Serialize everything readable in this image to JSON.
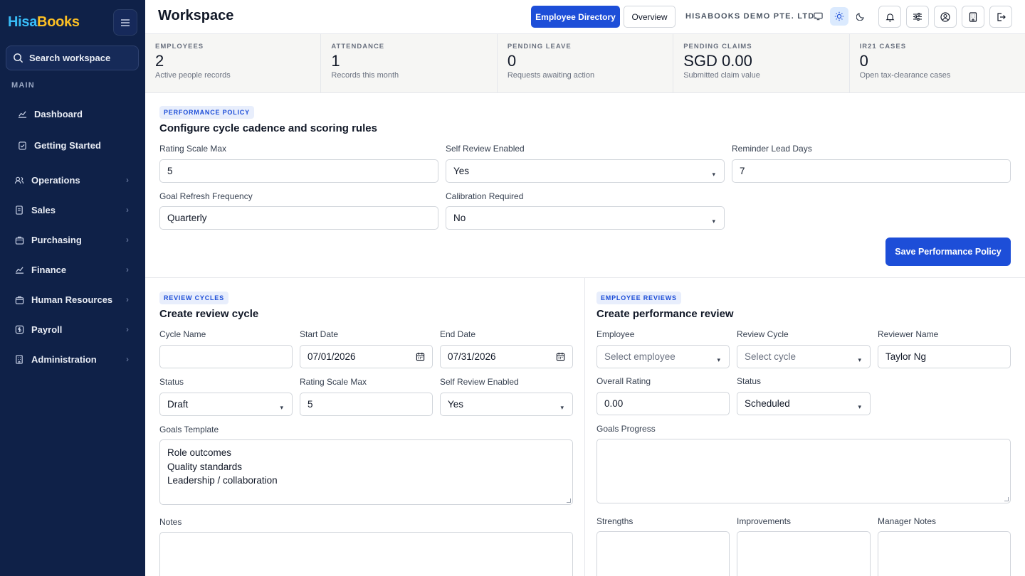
{
  "sidebar": {
    "logo_part1": "Hisa",
    "logo_part2": "Books",
    "search_placeholder": "Search workspace",
    "section_main": "MAIN",
    "items": [
      {
        "label": "Dashboard",
        "icon": "chart-line-icon"
      },
      {
        "label": "Getting Started",
        "icon": "checklist-icon"
      },
      {
        "label": "Operations",
        "icon": "users-icon"
      },
      {
        "label": "Sales",
        "icon": "receipt-icon"
      },
      {
        "label": "Purchasing",
        "icon": "bag-icon"
      },
      {
        "label": "Finance",
        "icon": "chart-line-icon"
      },
      {
        "label": "Human Resources",
        "icon": "briefcase-icon"
      },
      {
        "label": "Payroll",
        "icon": "dollar-icon"
      },
      {
        "label": "Administration",
        "icon": "building-icon"
      }
    ]
  },
  "header": {
    "title": "Workspace",
    "btn_directory": "Employee Directory",
    "btn_overview": "Overview",
    "company": "HISABOOKS DEMO PTE. LTD."
  },
  "stats": [
    {
      "label": "EMPLOYEES",
      "value": "2",
      "sub": "Active people records"
    },
    {
      "label": "ATTENDANCE",
      "value": "1",
      "sub": "Records this month"
    },
    {
      "label": "PENDING LEAVE",
      "value": "0",
      "sub": "Requests awaiting action"
    },
    {
      "label": "PENDING CLAIMS",
      "value": "SGD 0.00",
      "sub": "Submitted claim value"
    },
    {
      "label": "IR21 CASES",
      "value": "0",
      "sub": "Open tax-clearance cases"
    }
  ],
  "policy": {
    "tag": "PERFORMANCE POLICY",
    "title": "Configure cycle cadence and scoring rules",
    "rating_label": "Rating Scale Max",
    "rating_value": "5",
    "self_review_label": "Self Review Enabled",
    "self_review_value": "Yes",
    "reminder_label": "Reminder Lead Days",
    "reminder_value": "7",
    "goal_refresh_label": "Goal Refresh Frequency",
    "goal_refresh_value": "Quarterly",
    "calibration_label": "Calibration Required",
    "calibration_value": "No",
    "save_button": "Save Performance Policy"
  },
  "cycles": {
    "tag": "REVIEW CYCLES",
    "title": "Create review cycle",
    "name_label": "Cycle Name",
    "name_value": "",
    "start_label": "Start Date",
    "start_value": "07/01/2026",
    "end_label": "End Date",
    "end_value": "07/31/2026",
    "status_label": "Status",
    "status_value": "Draft",
    "rating_label": "Rating Scale Max",
    "rating_value": "5",
    "self_review_label": "Self Review Enabled",
    "self_review_value": "Yes",
    "goals_label": "Goals Template",
    "goals_lines": [
      "Role outcomes",
      "Quality standards",
      "Leadership / collaboration"
    ],
    "notes_label": "Notes"
  },
  "reviews": {
    "tag": "EMPLOYEE REVIEWS",
    "title": "Create performance review",
    "employee_label": "Employee",
    "employee_value": "Select employee",
    "cycle_label": "Review Cycle",
    "cycle_value": "Select cycle",
    "reviewer_label": "Reviewer Name",
    "reviewer_value": "Taylor Ng",
    "rating_label": "Overall Rating",
    "rating_value": "0.00",
    "status_label": "Status",
    "status_value": "Scheduled",
    "goals_progress_label": "Goals Progress",
    "strengths_label": "Strengths",
    "improvements_label": "Improvements",
    "manager_notes_label": "Manager Notes"
  }
}
